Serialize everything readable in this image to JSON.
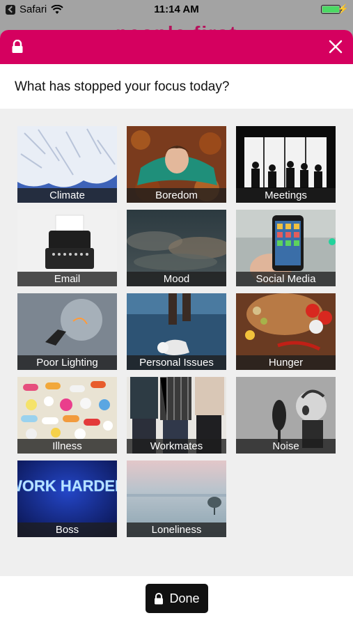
{
  "status_bar": {
    "back_app": "Safari",
    "time": "11:14 AM"
  },
  "app_header": {
    "brand": "people first"
  },
  "modal": {
    "question": "What has stopped your focus today?",
    "tiles": [
      {
        "label": "Climate",
        "art": "frost"
      },
      {
        "label": "Boredom",
        "art": "leaves"
      },
      {
        "label": "Meetings",
        "art": "silhouettes"
      },
      {
        "label": "Email",
        "art": "typewriter"
      },
      {
        "label": "Mood",
        "art": "clouds"
      },
      {
        "label": "Social Media",
        "art": "phone"
      },
      {
        "label": "Poor Lighting",
        "art": "bulb"
      },
      {
        "label": "Personal Issues",
        "art": "mannequin"
      },
      {
        "label": "Hunger",
        "art": "spices"
      },
      {
        "label": "Illness",
        "art": "pills"
      },
      {
        "label": "Workmates",
        "art": "people"
      },
      {
        "label": "Noise",
        "art": "shout"
      },
      {
        "label": "Boss",
        "art": "neon"
      },
      {
        "label": "Loneliness",
        "art": "tree"
      }
    ],
    "done_label": "Done"
  },
  "colors": {
    "accent": "#d5005f",
    "done_button": "#111111"
  },
  "icons": {
    "lock": "lock-icon",
    "close": "close-icon",
    "wifi": "wifi-icon",
    "battery": "battery-icon"
  }
}
